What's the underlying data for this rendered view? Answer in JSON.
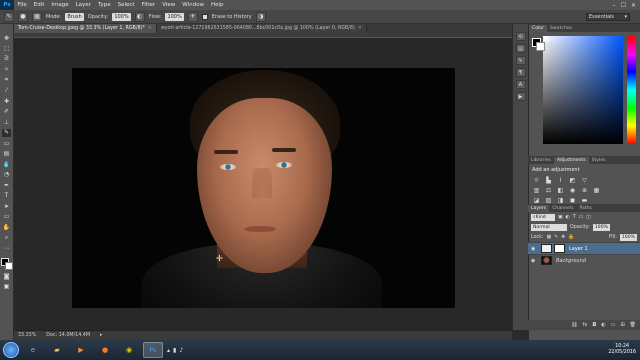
{
  "menu": {
    "items": [
      "File",
      "Edit",
      "Image",
      "Layer",
      "Type",
      "Select",
      "Filter",
      "View",
      "Window",
      "Help"
    ],
    "logo": "Ps",
    "window_controls": [
      "–",
      "☐",
      "✕"
    ]
  },
  "options": {
    "mode_label": "Mode:",
    "mode_value": "Brush",
    "opacity_label": "Opacity:",
    "opacity_value": "100%",
    "flow_label": "Flow:",
    "flow_value": "100%",
    "erase_history_label": "Erase to History",
    "workspace_value": "Essentials"
  },
  "tabs": [
    {
      "label": "Tom-Cruise-Desktop.jpeg @ 33.3% (Layer 1, RGB/8)*",
      "active": true
    },
    {
      "label": "wyoti-article-1271962631585-064080...8bc001c0a.jpg @ 100% (Layer 0, RGB/8)",
      "active": false
    }
  ],
  "status": {
    "zoom": "33.33%",
    "doc_size": "Doc: 14.0M/14.4M"
  },
  "panels": {
    "color_tabs": [
      "Color",
      "Swatches"
    ],
    "adjust_tabs": [
      "Libraries",
      "Adjustments",
      "Styles"
    ],
    "adjust_title": "Add an adjustment",
    "layers_tabs": [
      "Layers",
      "Channels",
      "Paths"
    ],
    "kind_label": "Kind",
    "blend_mode": "Normal",
    "opacity_label": "Opacity:",
    "opacity_value": "100%",
    "lock_label": "Lock:",
    "fill_label": "Fill:",
    "fill_value": "100%",
    "layers": [
      {
        "name": "Layer 1",
        "selected": true
      },
      {
        "name": "Background",
        "selected": false
      }
    ]
  },
  "taskbar": {
    "time": "10:24",
    "date": "22/05/2016"
  },
  "colors": {
    "accent_selection": "#4d6d8f",
    "ui_dark": "#535353",
    "canvas_bg": "#282828"
  },
  "icons": {
    "tools": [
      "move-icon",
      "marquee-icon",
      "lasso-icon",
      "quick-select-icon",
      "crop-icon",
      "eyedropper-icon",
      "healing-icon",
      "brush-icon",
      "clone-stamp-icon",
      "history-brush-icon",
      "eraser-icon",
      "gradient-icon",
      "blur-icon",
      "dodge-icon",
      "pen-icon",
      "type-icon",
      "path-select-icon",
      "shape-icon",
      "hand-icon",
      "zoom-icon"
    ]
  }
}
